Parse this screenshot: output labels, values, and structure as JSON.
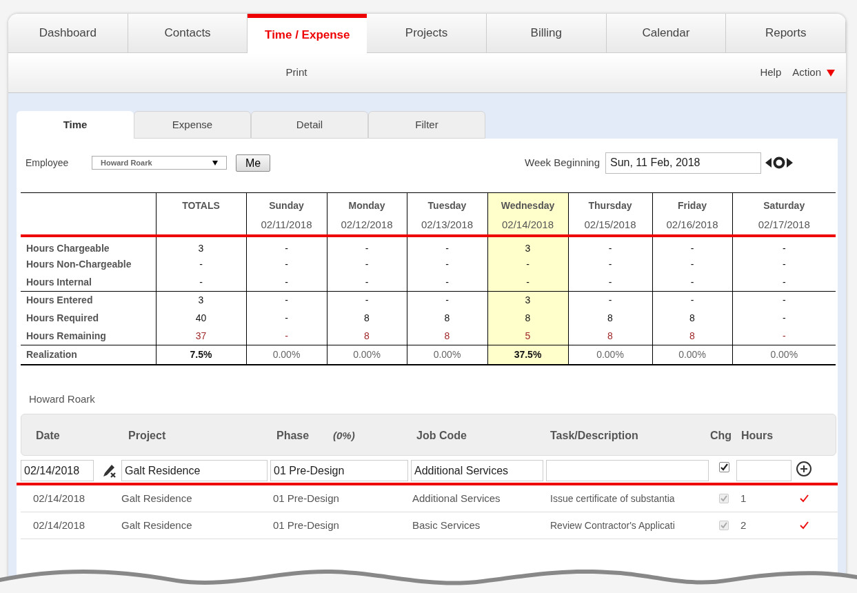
{
  "top_tabs": [
    {
      "label": "Dashboard",
      "selected": false
    },
    {
      "label": "Contacts",
      "selected": false
    },
    {
      "label": "Time / Expense",
      "selected": true
    },
    {
      "label": "Projects",
      "selected": false
    },
    {
      "label": "Billing",
      "selected": false
    },
    {
      "label": "Calendar",
      "selected": false
    },
    {
      "label": "Reports",
      "selected": false
    }
  ],
  "toolbar": {
    "print": "Print",
    "help": "Help",
    "action": "Action"
  },
  "sub_tabs": [
    {
      "label": "Time",
      "selected": true
    },
    {
      "label": "Expense",
      "selected": false
    },
    {
      "label": "Detail",
      "selected": false
    },
    {
      "label": "Filter",
      "selected": false
    }
  ],
  "employee": {
    "label": "Employee",
    "value": "Howard Roark",
    "me_button": "Me"
  },
  "week": {
    "label": "Week Beginning",
    "value": "Sun, 11 Feb, 2018"
  },
  "summary": {
    "totals_label": "TOTALS",
    "days": [
      {
        "name": "Sunday",
        "date": "02/11/2018",
        "selected": false
      },
      {
        "name": "Monday",
        "date": "02/12/2018",
        "selected": false
      },
      {
        "name": "Tuesday",
        "date": "02/13/2018",
        "selected": false
      },
      {
        "name": "Wednesday",
        "date": "02/14/2018",
        "selected": true
      },
      {
        "name": "Thursday",
        "date": "02/15/2018",
        "selected": false
      },
      {
        "name": "Friday",
        "date": "02/16/2018",
        "selected": false
      },
      {
        "name": "Saturday",
        "date": "02/17/2018",
        "selected": false
      }
    ],
    "sections": [
      {
        "rows": [
          {
            "label": "Hours Chargeable",
            "kind": "plain",
            "total": "3",
            "values": [
              "-",
              "-",
              "-",
              "3",
              "-",
              "-",
              "-"
            ]
          },
          {
            "label": "Hours Non-Chargeable",
            "kind": "plain",
            "total": "-",
            "values": [
              "-",
              "-",
              "-",
              "-",
              "-",
              "-",
              "-"
            ]
          },
          {
            "label": "Hours Internal",
            "kind": "plain",
            "total": "-",
            "values": [
              "-",
              "-",
              "-",
              "-",
              "-",
              "-",
              "-"
            ]
          }
        ]
      },
      {
        "rows": [
          {
            "label": "Hours Entered",
            "kind": "plain",
            "total": "3",
            "values": [
              "-",
              "-",
              "-",
              "3",
              "-",
              "-",
              "-"
            ]
          },
          {
            "label": "Hours Required",
            "kind": "plain",
            "total": "40",
            "values": [
              "-",
              "8",
              "8",
              "8",
              "8",
              "8",
              "-"
            ]
          },
          {
            "label": "Hours Remaining",
            "kind": "remaining",
            "total": "37",
            "values": [
              "-",
              "8",
              "8",
              "5",
              "8",
              "8",
              "-"
            ]
          }
        ]
      },
      {
        "rows": [
          {
            "label": "Realization",
            "kind": "realization",
            "total": "7.5%",
            "values": [
              "0.00%",
              "0.00%",
              "0.00%",
              "37.5%",
              "0.00%",
              "0.00%",
              "0.00%"
            ]
          }
        ]
      }
    ]
  },
  "entries": {
    "employee_name": "Howard Roark",
    "columns": [
      "Date",
      "Project",
      "Phase",
      "Job Code",
      "Task/Description",
      "Chg",
      "Hours"
    ],
    "phase_percent": "(0%)",
    "form": {
      "date": "02/14/2018",
      "project": "Galt Residence",
      "phase": "01 Pre-Design",
      "job_code": "Additional Services",
      "chargeable": true
    },
    "rows": [
      {
        "date": "02/14/2018",
        "project": "Galt Residence",
        "phase": "01 Pre-Design",
        "job_code": "Additional Services",
        "task": "Issue certificate of substantia",
        "chargeable": true,
        "hours": "1",
        "saved": true
      },
      {
        "date": "02/14/2018",
        "project": "Galt Residence",
        "phase": "01 Pre-Design",
        "job_code": "Basic Services",
        "task": "Review Contractor's Applicati",
        "chargeable": true,
        "hours": "2",
        "saved": true
      }
    ]
  }
}
